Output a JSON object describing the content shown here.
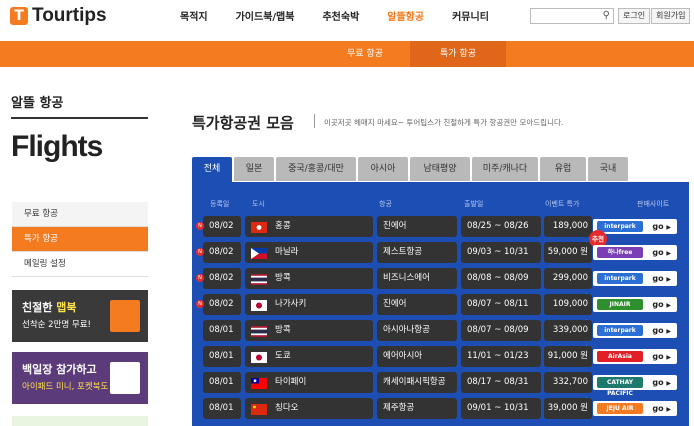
{
  "header": {
    "brand": "Tourtips",
    "nav": [
      "목적지",
      "가이드북/맵북",
      "추천숙박",
      "알뜰항공",
      "커뮤니티"
    ],
    "active_nav": 3,
    "login": "로그인",
    "join": "회원가입"
  },
  "subnav": [
    "무료 항공",
    "특가 항공"
  ],
  "sidebar": {
    "title": "알뜰 항공",
    "big_title": "Flights",
    "menu": [
      "무료 항공",
      "특가 항공",
      "메일링 설정"
    ],
    "active": 1,
    "banner1": {
      "prefix": "친절한",
      "highlight": "맵북",
      "line2": "선착순 2만명 무료!"
    },
    "banner2": {
      "line1": "백일장 참가하고",
      "line2": "아이패드 미니, 포켓북도 받자!"
    }
  },
  "main": {
    "title": "특가항공권 모음",
    "desc": "이곳저곳 헤매지 마세요~ 투어팁스가 친절하게 특가 항공권만 모아드립니다.",
    "tabs": [
      "전체",
      "일본",
      "중국/홍콩/대만",
      "아시아",
      "남태평양",
      "미주/캐나다",
      "유럽",
      "국내"
    ],
    "active_tab": 0,
    "columns": [
      "등록일",
      "도시",
      "항공",
      "출발일",
      "이벤트 특가",
      "판매사이트"
    ],
    "go_label": "go",
    "recommend_label": "추천",
    "rows": [
      {
        "date": "08/02",
        "new": true,
        "city": "홍콩",
        "flag": "hk",
        "airline": "진에어",
        "dep": "08/25 ~ 08/26",
        "price": "189,000 원",
        "seller": "interpark",
        "seller_color": "#2b6fd6"
      },
      {
        "date": "08/02",
        "new": true,
        "city": "마닐라",
        "flag": "ph",
        "airline": "제스트항공",
        "dep": "09/03 ~ 10/31",
        "price": "59,000 원",
        "seller": "하나free",
        "seller_color": "#7a3fb5",
        "recommend": true
      },
      {
        "date": "08/02",
        "new": true,
        "city": "방콕",
        "flag": "th",
        "airline": "비즈니스에어",
        "dep": "08/08 ~ 08/09",
        "price": "299,000 원",
        "seller": "interpark",
        "seller_color": "#2b6fd6"
      },
      {
        "date": "08/02",
        "new": true,
        "city": "나가사키",
        "flag": "jp",
        "airline": "진에어",
        "dep": "08/07 ~ 08/11",
        "price": "109,000 원",
        "seller": "JINAIR",
        "seller_color": "#2d8f2d"
      },
      {
        "date": "08/01",
        "new": false,
        "city": "방콕",
        "flag": "th",
        "airline": "아시아나항공",
        "dep": "08/07 ~ 08/09",
        "price": "339,000 원",
        "seller": "interpark",
        "seller_color": "#2b6fd6"
      },
      {
        "date": "08/01",
        "new": false,
        "city": "도쿄",
        "flag": "jp",
        "airline": "에어아시아",
        "dep": "11/01 ~ 01/23",
        "price": "91,000 원",
        "seller": "AirAsia",
        "seller_color": "#e01f26"
      },
      {
        "date": "08/01",
        "new": false,
        "city": "타이페이",
        "flag": "tw",
        "airline": "캐세이패시픽항공",
        "dep": "08/17 ~ 08/31",
        "price": "332,700 원",
        "seller": "CATHAY PACIFIC",
        "seller_color": "#1f7a6e"
      },
      {
        "date": "08/01",
        "new": false,
        "city": "칭다오",
        "flag": "cn",
        "airline": "제주항공",
        "dep": "09/01 ~ 10/31",
        "price": "39,000 원",
        "seller": "JEJU AIR",
        "seller_color": "#f47b20"
      }
    ]
  }
}
